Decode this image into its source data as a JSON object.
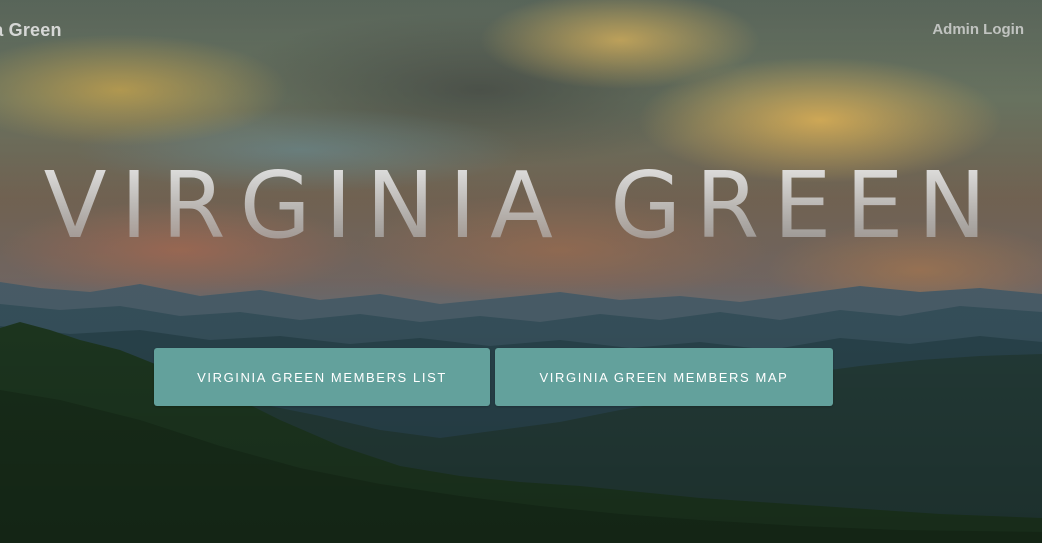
{
  "header": {
    "brand_partial": "ia Green",
    "admin_link": "Admin Login"
  },
  "hero": {
    "title": "VIRGINIA GREEN",
    "buttons": [
      {
        "label": "VIRGINIA GREEN MEMBERS LIST"
      },
      {
        "label": "VIRGINIA GREEN MEMBERS MAP"
      }
    ]
  },
  "colors": {
    "button_background": "#63a19c",
    "button_text": "#ffffff"
  }
}
